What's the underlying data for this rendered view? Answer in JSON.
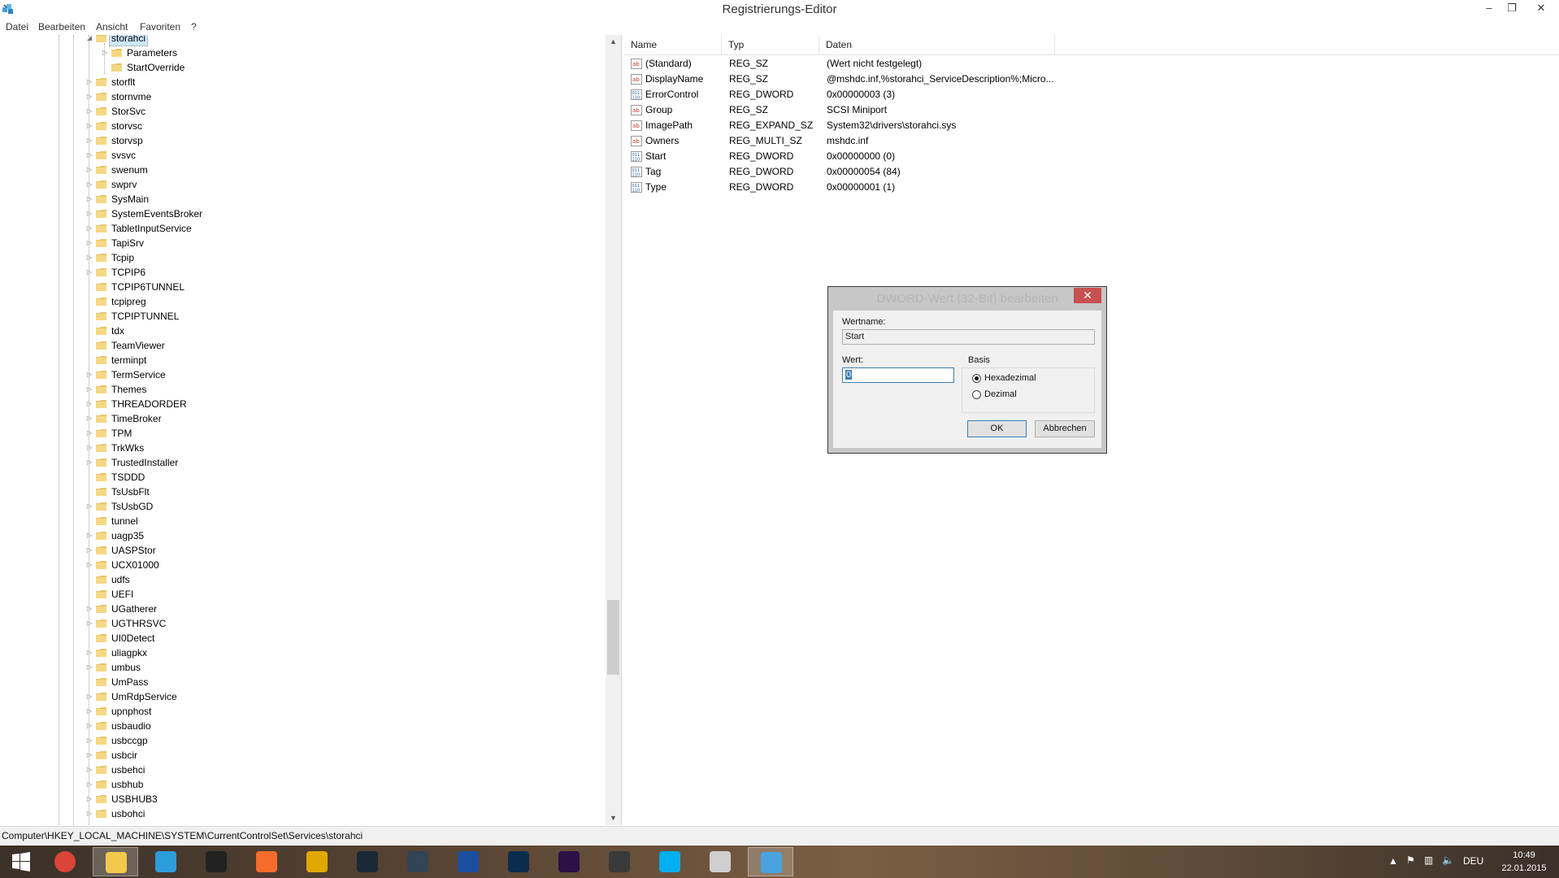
{
  "window": {
    "title": "Registrierungs-Editor",
    "controls": [
      "–",
      "❐",
      "✕"
    ]
  },
  "menu": [
    "Datei",
    "Bearbeiten",
    "Ansicht",
    "Favoriten",
    "?"
  ],
  "tree": {
    "root_expanded": "storahci",
    "children": [
      "Parameters",
      "StartOverride"
    ],
    "siblings": [
      "storflt",
      "stornvme",
      "StorSvc",
      "storvsc",
      "storvsp",
      "svsvc",
      "swenum",
      "swprv",
      "SysMain",
      "SystemEventsBroker",
      "TabletInputService",
      "TapiSrv",
      "Tcpip",
      "TCPIP6",
      "TCPIP6TUNNEL",
      "tcpipreg",
      "TCPIPTUNNEL",
      "tdx",
      "TeamViewer",
      "terminpt",
      "TermService",
      "Themes",
      "THREADORDER",
      "TimeBroker",
      "TPM",
      "TrkWks",
      "TrustedInstaller",
      "TSDDD",
      "TsUsbFlt",
      "TsUsbGD",
      "tunnel",
      "uagp35",
      "UASPStor",
      "UCX01000",
      "udfs",
      "UEFI",
      "UGatherer",
      "UGTHRSVC",
      "UI0Detect",
      "uliagpkx",
      "umbus",
      "UmPass",
      "UmRdpService",
      "upnphost",
      "usbaudio",
      "usbccgp",
      "usbcir",
      "usbehci",
      "usbhub",
      "USBHUB3",
      "usbohci"
    ],
    "no_expander": [
      "TCPIP6TUNNEL",
      "tcpipreg",
      "TCPIPTUNNEL",
      "tdx",
      "TeamViewer",
      "terminpt",
      "TSDDD",
      "TsUsbFlt",
      "tunnel",
      "udfs",
      "UEFI",
      "UI0Detect",
      "UmPass"
    ]
  },
  "list": {
    "columns": [
      "Name",
      "Typ",
      "Daten"
    ],
    "rows": [
      {
        "name": "(Standard)",
        "type": "REG_SZ",
        "data": "(Wert nicht festgelegt)",
        "icon": "string-value-icon"
      },
      {
        "name": "DisplayName",
        "type": "REG_SZ",
        "data": "@mshdc.inf,%storahci_ServiceDescription%;Micro...",
        "icon": "string-value-icon"
      },
      {
        "name": "ErrorControl",
        "type": "REG_DWORD",
        "data": "0x00000003 (3)",
        "icon": "binary-value-icon"
      },
      {
        "name": "Group",
        "type": "REG_SZ",
        "data": "SCSI Miniport",
        "icon": "string-value-icon"
      },
      {
        "name": "ImagePath",
        "type": "REG_EXPAND_SZ",
        "data": "System32\\drivers\\storahci.sys",
        "icon": "string-value-icon"
      },
      {
        "name": "Owners",
        "type": "REG_MULTI_SZ",
        "data": "mshdc.inf",
        "icon": "string-value-icon"
      },
      {
        "name": "Start",
        "type": "REG_DWORD",
        "data": "0x00000000 (0)",
        "icon": "binary-value-icon"
      },
      {
        "name": "Tag",
        "type": "REG_DWORD",
        "data": "0x00000054 (84)",
        "icon": "binary-value-icon"
      },
      {
        "name": "Type",
        "type": "REG_DWORD",
        "data": "0x00000001 (1)",
        "icon": "binary-value-icon"
      }
    ]
  },
  "dialog": {
    "title": "DWORD-Wert (32-Bit) bearbeiten",
    "close": "✕",
    "name_label": "Wertname:",
    "name_value": "Start",
    "value_label": "Wert:",
    "value_value": "0",
    "basis_label": "Basis",
    "radio_hex": "Hexadezimal",
    "radio_dec": "Dezimal",
    "selected_radio": "Hexadezimal",
    "ok": "OK",
    "cancel": "Abbrechen"
  },
  "status": {
    "path": "Computer\\HKEY_LOCAL_MACHINE\\SYSTEM\\CurrentControlSet\\Services\\storahci"
  },
  "taskbar": {
    "apps": [
      {
        "name": "windows-start-icon",
        "color": "#1e90ff"
      },
      {
        "name": "chrome-icon",
        "color": "#db4437"
      },
      {
        "name": "file-explorer-icon",
        "color": "#f2c94c"
      },
      {
        "name": "uplay-icon",
        "color": "#2d9cdb"
      },
      {
        "name": "unity-icon",
        "color": "#222222"
      },
      {
        "name": "origin-icon",
        "color": "#f56c2d"
      },
      {
        "name": "winamp-icon",
        "color": "#e0a800"
      },
      {
        "name": "steam-icon",
        "color": "#1b2838"
      },
      {
        "name": "media-icon",
        "color": "#334455"
      },
      {
        "name": "cinema4d-icon",
        "color": "#1a4fa0"
      },
      {
        "name": "photoshop-icon",
        "color": "#0b2c4d"
      },
      {
        "name": "after-effects-icon",
        "color": "#2b1145"
      },
      {
        "name": "movies-icon",
        "color": "#3a3a3a"
      },
      {
        "name": "skype-icon",
        "color": "#00aff0"
      },
      {
        "name": "notepad-icon",
        "color": "#cfcfcf"
      },
      {
        "name": "regedit-icon",
        "color": "#4aa3df"
      }
    ],
    "language": "DEU",
    "time": "10:49",
    "date": "22.01.2015"
  },
  "colors": {
    "selection": "#cce8ff",
    "dialog_close": "#c75050",
    "focus_border": "#3c7fb1"
  }
}
